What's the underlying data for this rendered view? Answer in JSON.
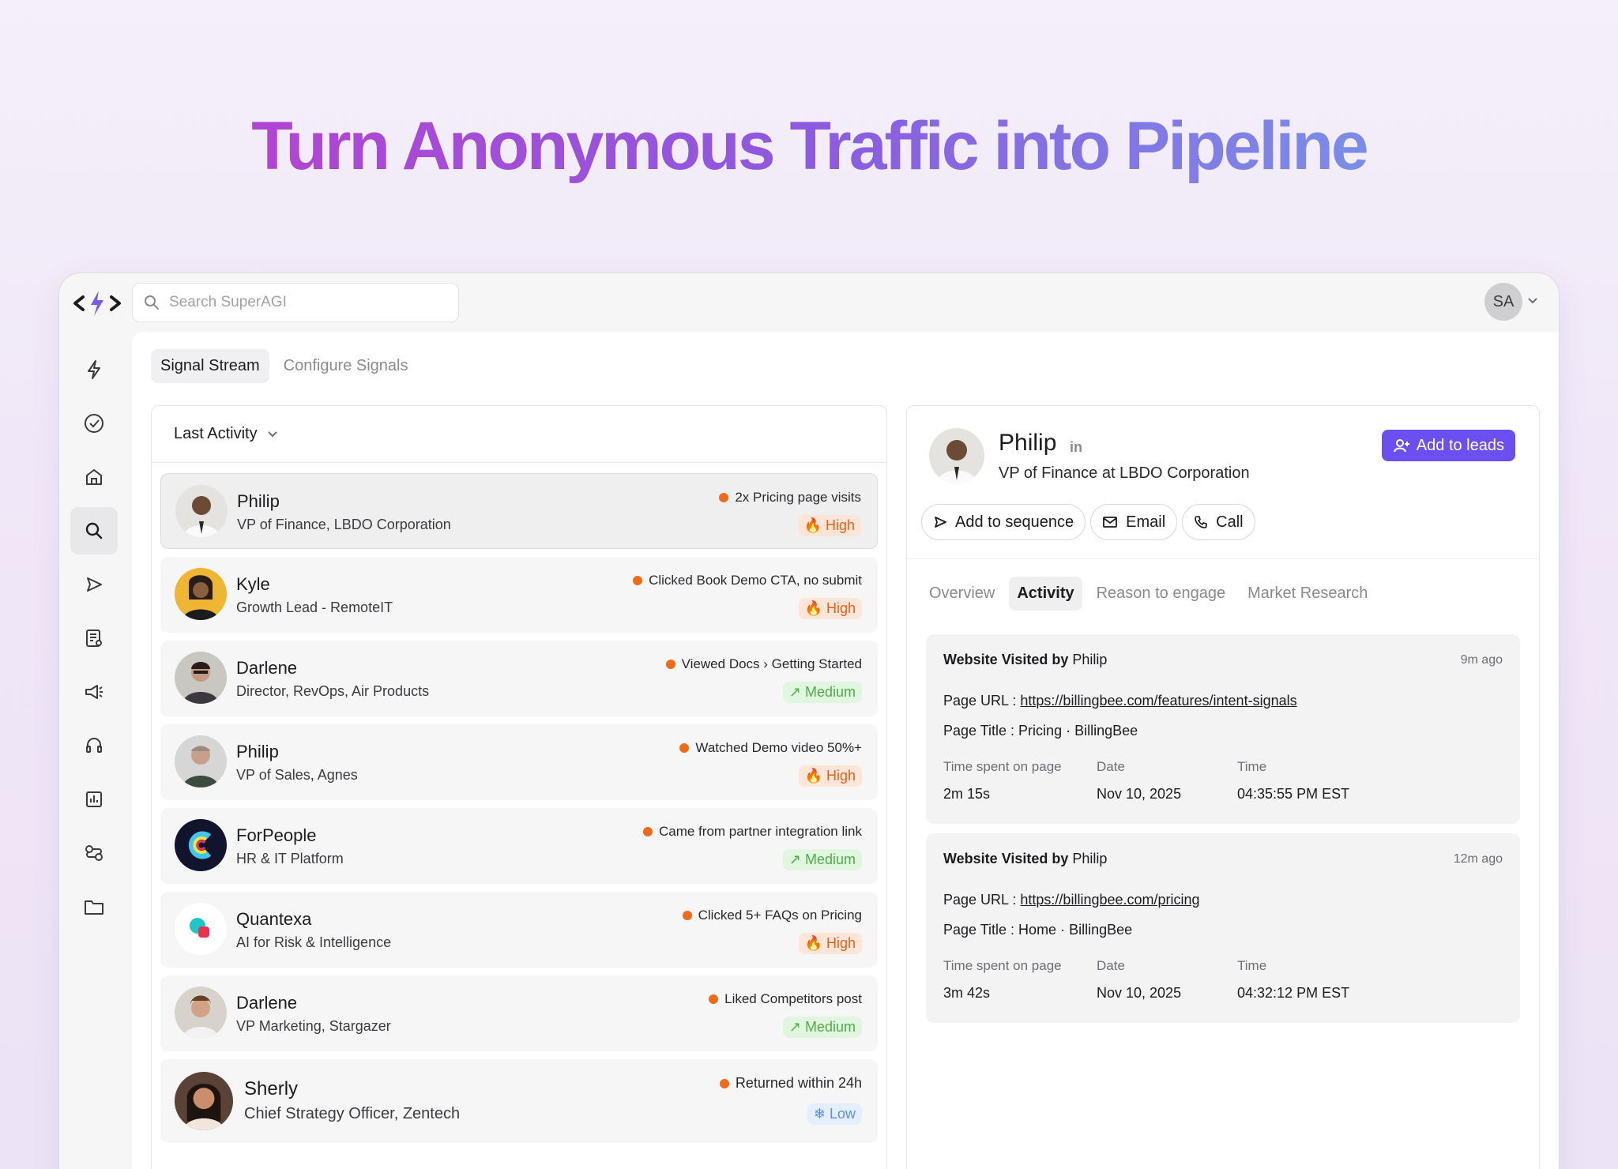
{
  "hero": {
    "title": "Turn Anonymous Traffic into Pipeline"
  },
  "topbar": {
    "search_placeholder": "Search SuperAGI",
    "avatar_initials": "SA"
  },
  "sidebar": {
    "items": [
      "bolt-icon",
      "check-circle-icon",
      "home-icon",
      "search-icon",
      "send-icon",
      "list-icon",
      "megaphone-icon",
      "headset-icon",
      "chart-icon",
      "integrations-icon",
      "folder-icon"
    ],
    "active_index": 3
  },
  "tabs": [
    "Signal Stream",
    "Configure Signals"
  ],
  "list": {
    "sort_label": "Last Activity",
    "rows": [
      {
        "name": "Philip",
        "sub": "VP of Finance, LBDO Corporation",
        "signal": "2x Pricing page visits",
        "badge": "High",
        "level": "high"
      },
      {
        "name": "Kyle",
        "sub": "Growth Lead - RemoteIT",
        "signal": "Clicked Book Demo CTA, no submit",
        "badge": "High",
        "level": "high"
      },
      {
        "name": "Darlene",
        "sub": "Director, RevOps, Air Products",
        "signal": "Viewed Docs › Getting Started",
        "badge": "Medium",
        "level": "medium"
      },
      {
        "name": "Philip",
        "sub": "VP of Sales, Agnes",
        "signal": "Watched Demo video 50%+",
        "badge": "High",
        "level": "high"
      },
      {
        "name": "ForPeople",
        "sub": "HR & IT Platform",
        "signal": "Came from partner integration link",
        "badge": "Medium",
        "level": "medium"
      },
      {
        "name": "Quantexa",
        "sub": "AI for Risk & Intelligence",
        "signal": "Clicked 5+ FAQs on Pricing",
        "badge": "High",
        "level": "high"
      },
      {
        "name": "Darlene",
        "sub": "VP Marketing, Stargazer",
        "signal": "Liked Competitors post",
        "badge": "Medium",
        "level": "medium"
      },
      {
        "name": "Sherly",
        "sub": "Chief Strategy Officer, Zentech",
        "signal": "Returned within 24h",
        "badge": "Low",
        "level": "low"
      }
    ]
  },
  "detail": {
    "name": "Philip",
    "in_label": "in",
    "title": "VP of Finance at LBDO Corporation",
    "add_leads": "Add to leads",
    "actions": [
      "Add to sequence",
      "Email",
      "Call"
    ],
    "tabs": [
      "Overview",
      "Activity",
      "Reason to engage",
      "Market Research"
    ],
    "active_tab": "Activity",
    "cards": [
      {
        "title_bold": "Website Visited by",
        "title_name": "Philip",
        "ago": "9m ago",
        "url_label": "Page URL :",
        "url": "https://billingbee.com/features/intent-signals",
        "page_title": "Page Title : Pricing · BillingBee",
        "time_spent_label": "Time spent on page",
        "time_spent": "2m 15s",
        "date_label": "Date",
        "date": "Nov 10, 2025",
        "time_label": "Time",
        "time": "04:35:55 PM EST"
      },
      {
        "title_bold": "Website Visited by",
        "title_name": "Philip",
        "ago": "12m ago",
        "url_label": "Page URL :",
        "url": "https://billingbee.com/pricing",
        "page_title": "Page Title : Home · BillingBee",
        "time_spent_label": "Time spent on page",
        "time_spent": "3m 42s",
        "date_label": "Date",
        "date": "Nov 10, 2025",
        "time_label": "Time",
        "time": "04:32:12 PM EST"
      }
    ]
  },
  "colors": {
    "accent": "#6b4ff0",
    "high": "#e9601a",
    "medium": "#4fae4a",
    "low": "#5b8fe6",
    "signal_dot": "#f06a1a"
  }
}
